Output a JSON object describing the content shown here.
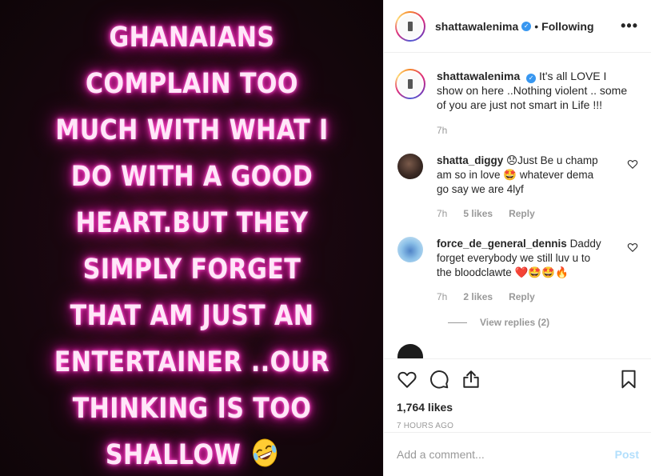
{
  "post": {
    "image_text": "GHANAIANS COMPLAIN TOO MUCH WITH WHAT I DO WITH A GOOD HEART.BUT THEY SIMPLY FORGET THAT AM JUST AN ENTERTAINER ..OUR THINKING IS TOO SHALLOW",
    "image_emoji": "rolling-on-floor-laughing"
  },
  "header": {
    "username": "shattawalenima",
    "separator": "•",
    "follow_status": "Following",
    "more": "•••"
  },
  "caption": {
    "username": "shattawalenima",
    "text": "It's all LOVE I show on here ..Nothing violent .. some of you are just not smart in Life !!!",
    "time": "7h"
  },
  "comments": [
    {
      "username": "shatta_diggy",
      "text": "😞Just Be u champ am so in love 🤩 whatever dema go say we are 4lyf",
      "time": "7h",
      "likes": "5 likes",
      "reply": "Reply"
    },
    {
      "username": "force_de_general_dennis",
      "text": "Daddy forget everybody we still luv u to the bloodclawte ❤️🤩🤩🔥",
      "time": "7h",
      "likes": "2 likes",
      "reply": "Reply"
    }
  ],
  "view_replies": "View replies (2)",
  "actions": {
    "likes": "1,764 likes",
    "time_ago": "7 HOURS AGO"
  },
  "add_comment": {
    "placeholder": "Add a comment...",
    "post_label": "Post"
  },
  "colors": {
    "neon_pink": "#ff2fbf",
    "verified_blue": "#3897f0",
    "post_button_disabled": "#b2dffc"
  }
}
